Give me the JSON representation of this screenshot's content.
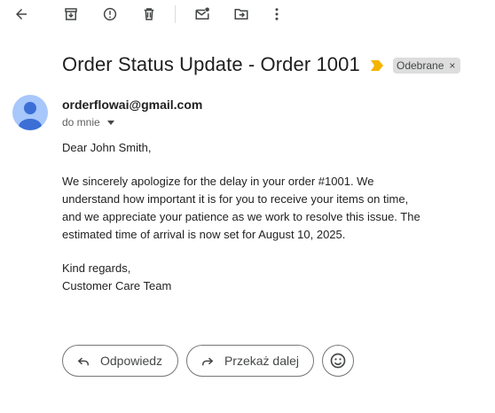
{
  "toolbar": {
    "icons": [
      "back-arrow-icon",
      "archive-icon",
      "report-spam-icon",
      "delete-icon",
      "mark-unread-icon",
      "move-to-icon",
      "more-options-icon"
    ]
  },
  "email": {
    "subject": "Order Status Update - Order 1001",
    "label": "Odebrane",
    "label_remove": "×",
    "sender": "orderflowai@gmail.com",
    "recipient": "do mnie",
    "body": {
      "greeting": "Dear John Smith,",
      "paragraph_lines": [
        "We sincerely apologize for the delay in your order #1001. We",
        "understand how important it is for you to receive your items on time,",
        "and we appreciate your patience as we work to resolve this issue. The",
        "estimated time of arrival is now set for August 10, 2025."
      ],
      "closing": "Kind regards,",
      "signature": "Customer Care Team"
    }
  },
  "actions": {
    "reply_label": "Odpowiedz",
    "forward_label": "Przekaż dalej"
  },
  "colors": {
    "importance": "#f4b400",
    "avatar_bg": "#a8c7fa",
    "avatar_fg": "#3b6fd6",
    "chip_bg": "#dddddd"
  }
}
